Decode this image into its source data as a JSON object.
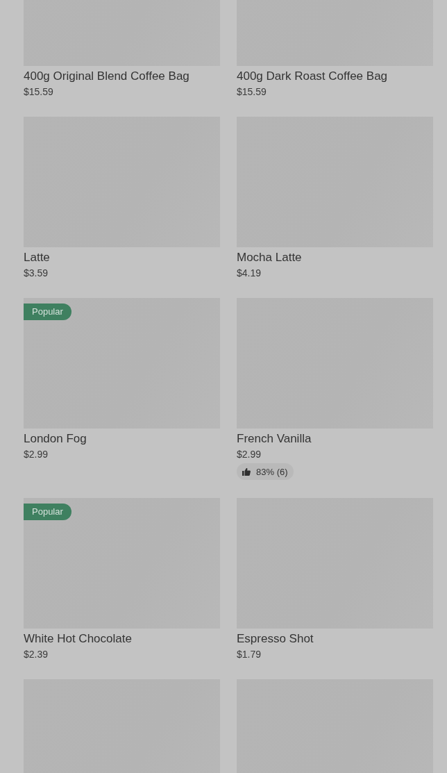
{
  "products": [
    {
      "kind": "picture",
      "name": "400g Original Blend Coffee Bag",
      "price": "$15.59"
    },
    {
      "kind": "picture",
      "name": "400g Dark Roast Coffee Bag",
      "price": "$15.59"
    },
    {
      "kind": "picture",
      "name": "Latte",
      "price": "$3.59"
    },
    {
      "kind": "picture",
      "name": "Mocha Latte",
      "price": "$4.19"
    },
    {
      "kind": "picture",
      "badge": "Popular",
      "name": "London Fog",
      "price": "$2.99"
    },
    {
      "kind": "picture",
      "name": "French Vanilla",
      "price": "$2.99",
      "rating": "83% (6)"
    },
    {
      "kind": "picture",
      "badge": "Popular",
      "name": "White Hot Chocolate",
      "price": "$2.39"
    },
    {
      "kind": "picture",
      "name": "Espresso Shot",
      "price": "$1.79"
    },
    {
      "kind": "picture"
    },
    {
      "kind": "picture"
    }
  ]
}
